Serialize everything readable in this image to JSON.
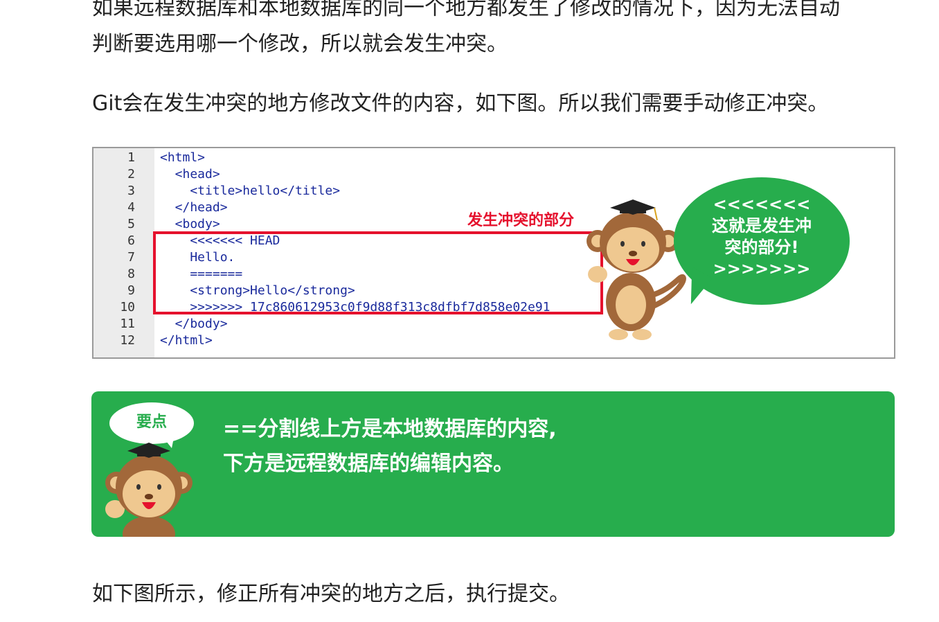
{
  "paragraphs": {
    "p1_line1": "如果远程数据库和本地数据库的同一个地方都发生了修改的情况下，因为无法自动",
    "p1_line2": "判断要选用哪一个修改，所以就会发生冲突。",
    "p2": "Git会在发生冲突的地方修改文件的内容，如下图。所以我们需要手动修正冲突。",
    "p3": "如下图所示，修正所有冲突的地方之后，执行提交。"
  },
  "code_figure": {
    "line_numbers": [
      "1",
      "2",
      "3",
      "4",
      "5",
      "6",
      "7",
      "8",
      "9",
      "10",
      "11",
      "12"
    ],
    "lines": [
      "<html>",
      "  <head>",
      "    <title>hello</title>",
      "  </head>",
      "  <body>",
      "    <<<<<<< HEAD",
      "    Hello.",
      "    =======",
      "    <strong>Hello</strong>",
      "    >>>>>>> 17c860612953c0f9d88f313c8dfbf7d858e02e91",
      "  </body>",
      "</html>"
    ],
    "conflict_label": "发生冲突的部分",
    "bubble_lines": [
      "<<<<<<<",
      "这就是发生冲",
      "突的部分!",
      ">>>>>>>"
    ]
  },
  "tip": {
    "badge": "要点",
    "line1": "==分割线上方是本地数据库的内容,",
    "line2": "下方是远程数据库的编辑内容。"
  },
  "colors": {
    "green": "#27ad4d",
    "red": "#e5112d",
    "code_tag": "#1a2a9c"
  }
}
